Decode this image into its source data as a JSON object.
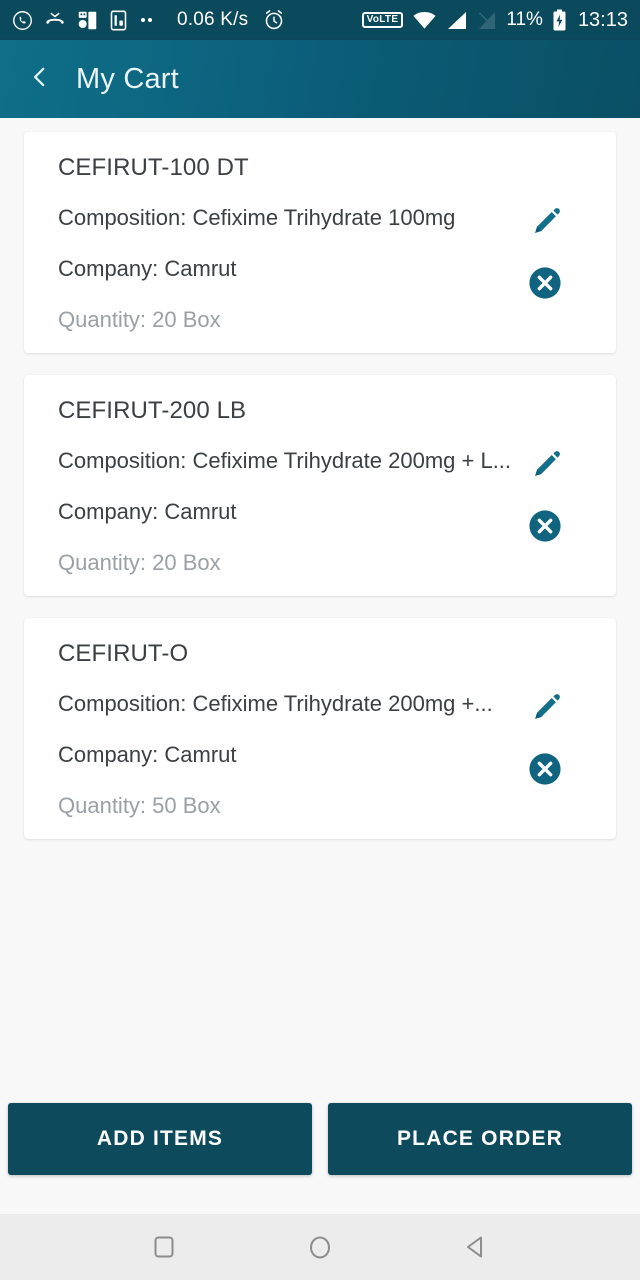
{
  "statusbar": {
    "network_speed": "0.06 K/s",
    "volte_label": "VoLTE",
    "battery_percent": "11%",
    "time": "13:13",
    "icons": [
      "whatsapp-icon",
      "missed-call-icon",
      "apps-icon",
      "sim-card-icon",
      "more-dots-icon",
      "alarm-icon",
      "volte-badge",
      "wifi-icon",
      "signal-icon",
      "signal-off-icon",
      "battery-charging-icon"
    ]
  },
  "appbar": {
    "back_icon": "chevron-left-icon",
    "title": "My Cart"
  },
  "cart": {
    "items": [
      {
        "name": "CEFIRUT-100 DT",
        "composition": "Composition: Cefixime Trihydrate 100mg",
        "company": "Company: Camrut",
        "quantity": "Quantity: 20 Box",
        "edit_icon": "pencil-icon",
        "delete_icon": "close-circle-icon"
      },
      {
        "name": "CEFIRUT-200 LB",
        "composition": "Composition: Cefixime Trihydrate 200mg + L...",
        "company": "Company: Camrut",
        "quantity": "Quantity: 20 Box",
        "edit_icon": "pencil-icon",
        "delete_icon": "close-circle-icon"
      },
      {
        "name": "CEFIRUT-O",
        "composition": "Composition: Cefixime Trihydrate 200mg +...",
        "company": "Company: Camrut",
        "quantity": "Quantity: 50 Box",
        "edit_icon": "pencil-icon",
        "delete_icon": "close-circle-icon"
      }
    ]
  },
  "footer": {
    "add_items_label": "ADD ITEMS",
    "place_order_label": "PLACE ORDER"
  },
  "navbar": {
    "recents_icon": "square-icon",
    "home_icon": "circle-icon",
    "back_icon": "triangle-back-icon"
  },
  "colors": {
    "appbar_start": "#0f6f88",
    "appbar_end": "#0a4f66",
    "statusbar": "#0b4a5c",
    "accent": "#0d6681",
    "button": "#0d4a5c",
    "page_bg": "#f8f8f8",
    "card_bg": "#ffffff",
    "text_primary": "#3c4043",
    "text_muted": "#9aa0a6"
  }
}
